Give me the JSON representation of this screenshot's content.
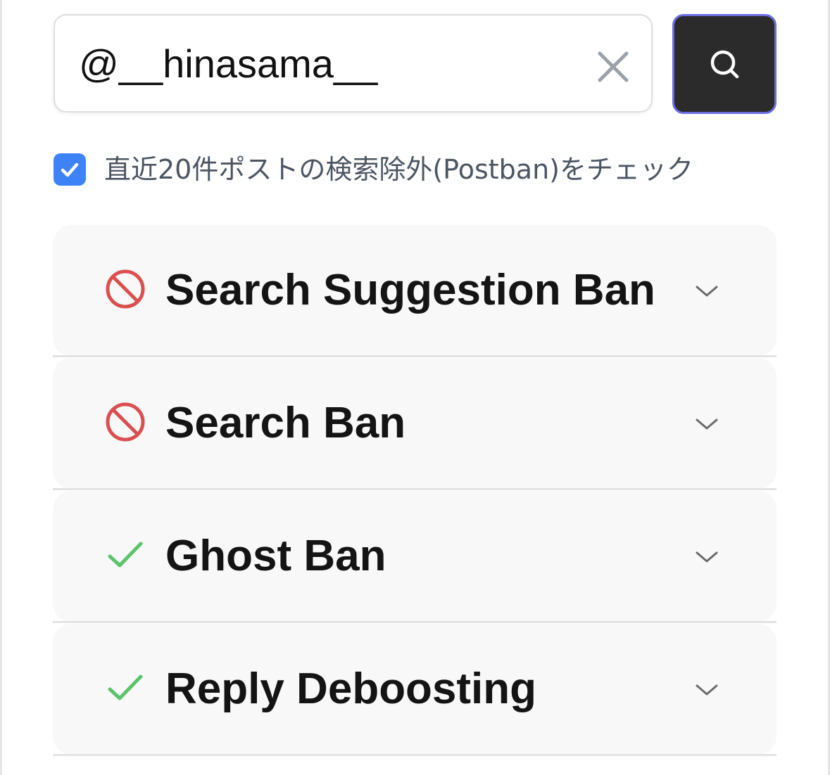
{
  "search": {
    "value": "@__hinasama__",
    "clear_icon": "close-icon",
    "submit_icon": "search-icon",
    "button_border_color": "#6a6de0",
    "button_bg_color": "#2b2b2b"
  },
  "option": {
    "checked": true,
    "label": "直近20件ポストの検索除外(Postban)をチェック",
    "accent_color": "#3d82f6"
  },
  "results": [
    {
      "title": "Search Suggestion Ban",
      "status": "banned",
      "status_icon": "prohibited-icon",
      "status_color": "#db4f4f"
    },
    {
      "title": "Search Ban",
      "status": "banned",
      "status_icon": "prohibited-icon",
      "status_color": "#db4f4f"
    },
    {
      "title": "Ghost Ban",
      "status": "ok",
      "status_icon": "checkmark-icon",
      "status_color": "#5bc46b"
    },
    {
      "title": "Reply Deboosting",
      "status": "ok",
      "status_icon": "checkmark-icon",
      "status_color": "#5bc46b"
    }
  ]
}
